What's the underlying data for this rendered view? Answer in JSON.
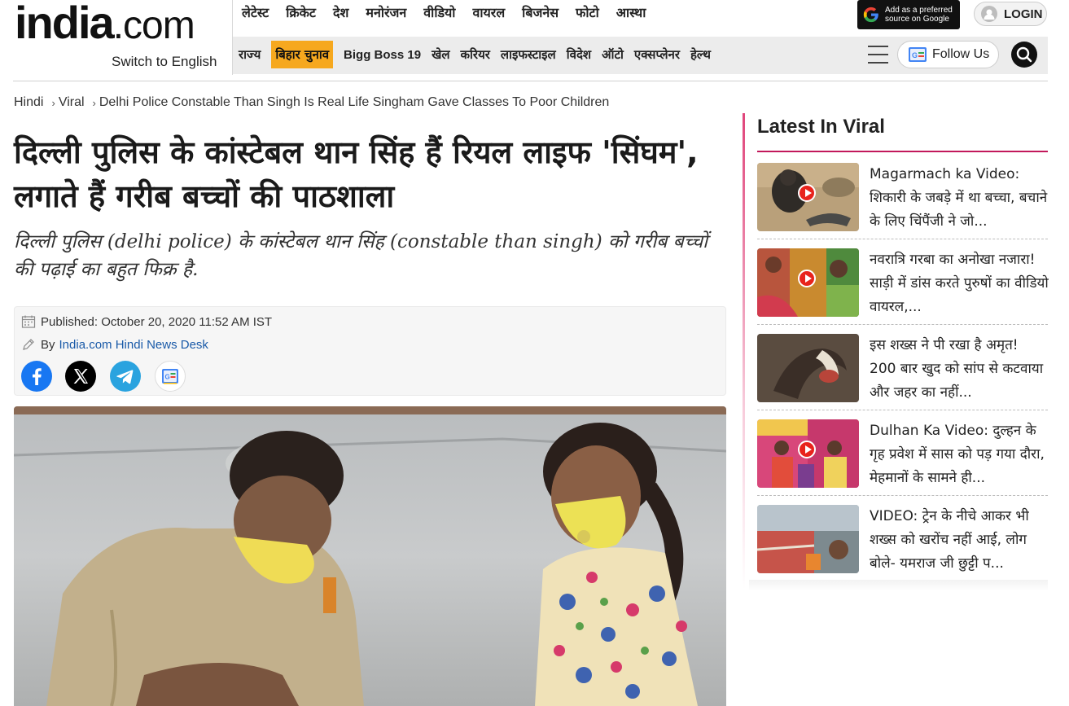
{
  "header": {
    "logo_main": "india",
    "logo_suffix": ".com",
    "switch_language": "Switch to English",
    "top_nav": [
      "लेटेस्ट",
      "क्रिकेट",
      "देश",
      "मनोरंजन",
      "वीडियो",
      "वायरल",
      "बिजनेस",
      "फोटो",
      "आस्था"
    ],
    "second_nav": [
      "राज्य",
      "बिहार चुनाव",
      "Bigg Boss 19",
      "खेल",
      "करियर",
      "लाइफस्टाइल",
      "विदेश",
      "ऑटो",
      "एक्सप्लेनर",
      "हेल्थ"
    ],
    "highlighted_item": "बिहार चुनाव",
    "google_pref_line1": "Add as a preferred",
    "google_pref_line2": "source on Google",
    "login_label": "LOGIN",
    "follow_label": "Follow Us",
    "icons": {
      "hamburger": "menu-icon",
      "search": "search-icon",
      "user": "user-icon",
      "google": "google-g-icon",
      "google_news": "google-news-icon"
    }
  },
  "breadcrumb": {
    "items": [
      "Hindi",
      "Viral"
    ],
    "current": "Delhi Police Constable Than Singh Is Real Life Singham Gave Classes To Poor Children"
  },
  "article": {
    "headline": "दिल्ली पुलिस के कांस्टेबल थान सिंह हैं रियल लाइफ 'सिंघम', लगाते हैं गरीब बच्चों की पाठशाला",
    "subheadline": "दिल्ली पुलिस (delhi police) के कांस्टेबल थान सिंह (constable than singh) को गरीब बच्चों की पढ़ाई का बहुत फिक्र है.",
    "published": "Published: October 20, 2020 11:52 AM IST",
    "by_label": "By",
    "author": "India.com Hindi News Desk",
    "share_icons": [
      "facebook-icon",
      "x-icon",
      "telegram-icon",
      "google-news-icon"
    ]
  },
  "sidebar": {
    "title": "Latest In Viral",
    "items": [
      {
        "title": "Magarmach ka Video: शिकारी के जबड़े में था बच्चा, बचाने के लिए चिंपैंजी ने जो...",
        "video": true
      },
      {
        "title": "नवरात्रि गरबा का अनोखा नजारा! साड़ी में डांस करते पुरुषों का वीडियो वायरल,...",
        "video": true
      },
      {
        "title": "इस शख्स ने पी रखा है अमृत! 200 बार खुद को सांप से कटवाया और जहर का नहीं...",
        "video": false
      },
      {
        "title": "Dulhan Ka Video: दुल्हन के गृह प्रवेश में सास को पड़ गया दौरा, मेहमानों के सामने ही...",
        "video": true
      },
      {
        "title": "VIDEO: ट्रेन के नीचे आकर भी शख्स को खरोंच नहीं आई, लोग बोले- यमराज जी छुट्टी प...",
        "video": false
      }
    ]
  },
  "colors": {
    "highlight": "#f6a81e",
    "accent": "#c2185b",
    "link": "#1a5aa8"
  }
}
